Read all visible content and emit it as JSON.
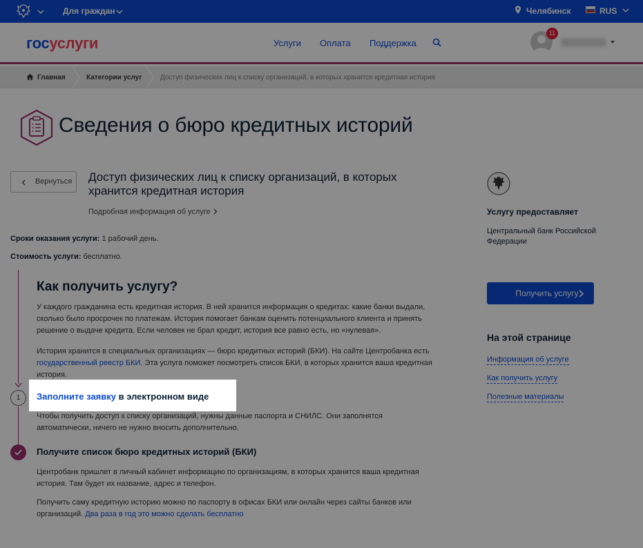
{
  "topbar": {
    "for_citizens": "Для граждан",
    "city": "Челябинск",
    "lang": "RUS",
    "bg_color": "#0d4cd3"
  },
  "header": {
    "logo_part1": "гос",
    "logo_part2": "услуги",
    "nav": [
      "Услуги",
      "Оплата",
      "Поддержка"
    ],
    "notifications_count": "11",
    "accent_color": "#9b2f6d"
  },
  "breadcrumbs": {
    "home": "Главная",
    "category": "Категории услуг",
    "current": "Доступ физических лиц к списку организаций, в которых хранится кредитная история"
  },
  "page": {
    "title": "Сведения о бюро кредитных историй",
    "back": "Вернуться",
    "service_title": "Доступ физических лиц к списку организаций, в которых хранится кредитная история",
    "details_link": "Подробная информация об услуге",
    "term_label": "Сроки оказания услуги:",
    "term_value": " 1 рабочий день.",
    "cost_label": "Стоимость услуги:",
    "cost_value": " бесплатно."
  },
  "how_to": {
    "heading": "Как получить услугу?",
    "p1": "У каждого гражданина есть кредитная история. В ней хранится информация о кредитах: какие банки выдали, сколько было просрочек по платежам. История помогает банкам оценить потенциального клиента и принять решение о выдаче кредита. Если человек не брал кредит, история все равно есть, но «нулевая».",
    "p2_before": "История хранится в специальных организациях — бюро кредитных историй (БКИ). На сайте Центробанка есть ",
    "p2_link": "государственный реестр БКИ",
    "p2_after": ". Эта услуга поможет посмотреть список БКИ, в которых хранится ваша кредитная история.",
    "step1_num": "1",
    "step1_link": "Заполните заявку",
    "step1_text": " в электронном виде",
    "step1_desc": "Чтобы получить доступ к списку организаций, нужны данные паспорта и СНИЛС. Они заполнятся автоматически, ничего не нужно вносить дополнительно.",
    "step2_title": "Получите список бюро кредитных историй (БКИ)",
    "step2_p1": "Центробанк пришлет в личный кабинет информацию по организациям, в которых хранится ваша кредитная история. Там будет их название, адрес и телефон.",
    "step2_p2_before": "Получить саму кредитную историю можно по паспорту в офисах БКИ или онлайн через сайты банков или организаций. ",
    "step2_p2_link": "Два раза в год это можно сделать бесплатно"
  },
  "sidebar": {
    "provider_label": "Услугу предоставляет",
    "provider_name": "Центральный банк Российской Федерации",
    "get_service": "Получить услугу",
    "on_page": "На этой странице",
    "toc": [
      "Информация об услуге",
      "Как получить услугу",
      "Полезные материалы"
    ]
  }
}
